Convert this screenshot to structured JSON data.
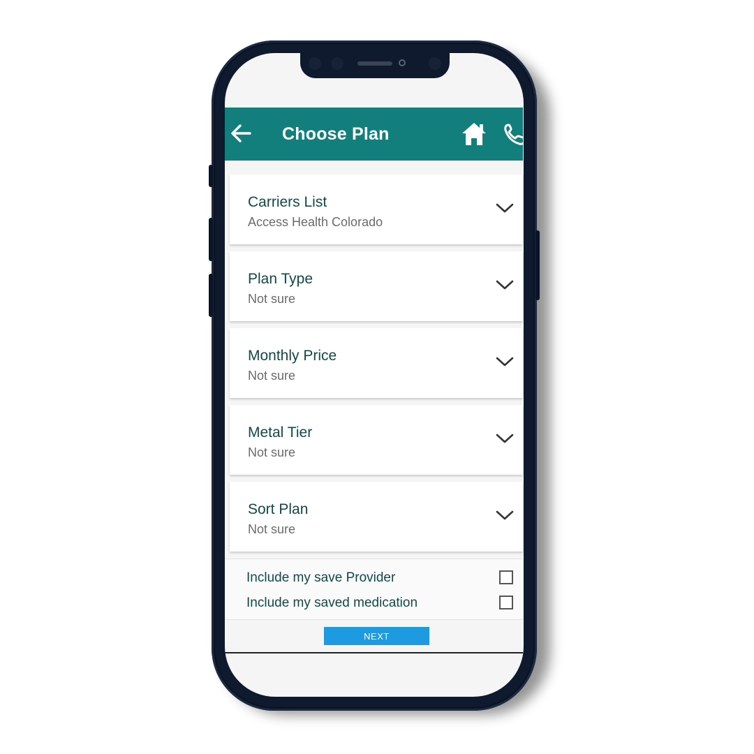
{
  "header": {
    "title": "Choose Plan",
    "back_icon": "arrow-left-icon",
    "home_icon": "home-icon",
    "call_icon": "phone-icon",
    "background_color": "#127f7d"
  },
  "filters": [
    {
      "label": "Carriers List",
      "value": "Access Health Colorado"
    },
    {
      "label": "Plan Type",
      "value": "Not sure"
    },
    {
      "label": "Monthly Price",
      "value": "Not sure"
    },
    {
      "label": "Metal Tier",
      "value": "Not sure"
    },
    {
      "label": "Sort Plan",
      "value": "Not sure"
    }
  ],
  "options": [
    {
      "label": "Include my save Provider",
      "checked": false
    },
    {
      "label": "Include my saved medication",
      "checked": false
    }
  ],
  "next_button": {
    "label": "NEXT",
    "color": "#1e9be0"
  }
}
